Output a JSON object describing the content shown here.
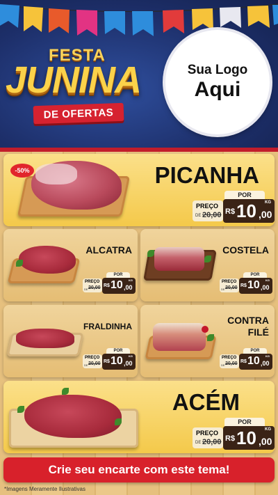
{
  "header": {
    "festa_top": "FESTA",
    "festa_main": "JUNINA",
    "festa_sub": "DE OFERTAS",
    "logo_line1": "Sua Logo",
    "logo_line2": "Aqui"
  },
  "products": [
    {
      "name": "PICANHA",
      "badge": "-50%",
      "por": "POR",
      "preco": "PREÇO",
      "de": "DE",
      "old": "20,00",
      "currency": "R$",
      "price_int": "10",
      "price_cents": ",00",
      "unit": "KG"
    },
    {
      "name": "ALCATRA",
      "por": "POR",
      "preco": "PREÇO",
      "de": "DE",
      "old": "20,00",
      "currency": "R$",
      "price_int": "10",
      "price_cents": ",00",
      "unit": "KG"
    },
    {
      "name": "COSTELA",
      "por": "POR",
      "preco": "PREÇO",
      "de": "DE",
      "old": "20,00",
      "currency": "R$",
      "price_int": "10",
      "price_cents": ",00",
      "unit": "KG"
    },
    {
      "name": "FRALDINHA",
      "por": "POR",
      "preco": "PREÇO",
      "de": "DE",
      "old": "20,00",
      "currency": "R$",
      "price_int": "10",
      "price_cents": ",00",
      "unit": "KG"
    },
    {
      "name": "CONTRA FILÉ",
      "por": "POR",
      "preco": "PREÇO",
      "de": "DE",
      "old": "20,00",
      "currency": "R$",
      "price_int": "10",
      "price_cents": ",00",
      "unit": "KG"
    },
    {
      "name": "ACÉM",
      "por": "POR",
      "preco": "PREÇO",
      "de": "DE",
      "old": "20,00",
      "currency": "R$",
      "price_int": "10",
      "price_cents": ",00",
      "unit": "KG"
    }
  ],
  "footer": {
    "cta": "Crie seu encarte com este tema!",
    "note": "*Imagens Meramente Ilustrativas"
  },
  "colors": {
    "accent_red": "#d8212b",
    "header_blue": "#1d2f6a",
    "card_yellow": "#f4c94a",
    "price_brown": "#3a2316"
  }
}
